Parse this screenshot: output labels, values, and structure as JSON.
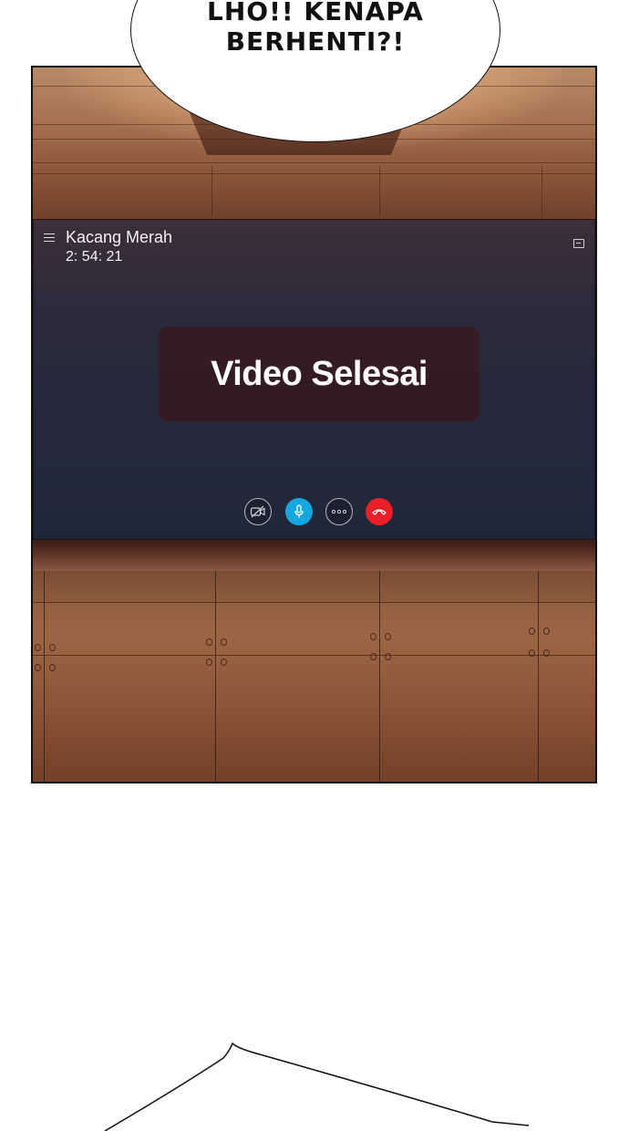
{
  "speech_bubble": {
    "line1": "LHO!! KENAPA",
    "line2": "BERHENTI?!"
  },
  "call": {
    "caller_name": "Kacang Merah",
    "duration": "2: 54: 21",
    "status": "Video Selesai",
    "controls": {
      "camera": "camera-off-icon",
      "mic": "microphone-icon",
      "more": "more-options-icon",
      "end": "end-call-icon"
    }
  },
  "colors": {
    "mic_blue": "#17a7e0",
    "end_red": "#e8202a"
  }
}
